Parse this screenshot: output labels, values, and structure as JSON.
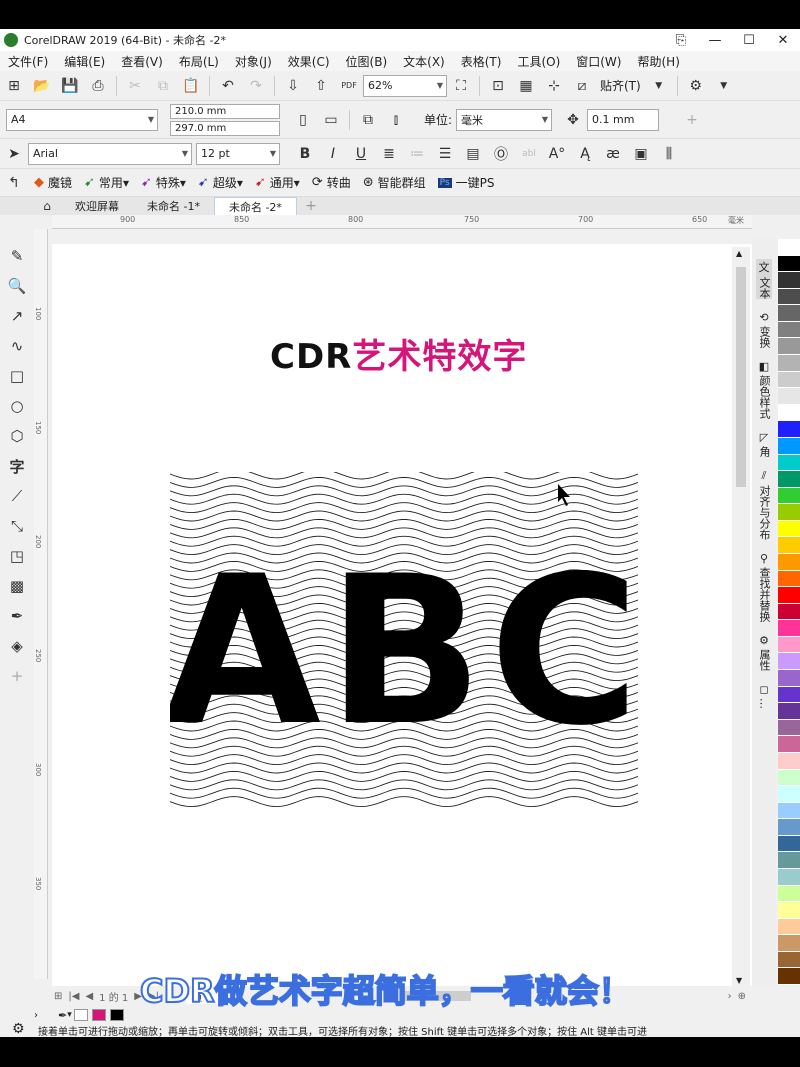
{
  "window": {
    "title": "CorelDRAW 2019 (64-Bit) - 未命名 -2*",
    "controls": [
      "⎘",
      "—",
      "☐",
      "✕"
    ]
  },
  "menu": [
    "文件(F)",
    "编辑(E)",
    "查看(V)",
    "布局(L)",
    "对象(J)",
    "效果(C)",
    "位图(B)",
    "文本(X)",
    "表格(T)",
    "工具(O)",
    "窗口(W)",
    "帮助(H)"
  ],
  "toolbar1": {
    "zoom": "62%",
    "snap_label": "贴齐(T)",
    "pdf_label": "PDF"
  },
  "toolbar2": {
    "page_size": "A4",
    "width": "210.0 mm",
    "height": "297.0 mm",
    "unit_label": "单位:",
    "unit_value": "毫米",
    "nudge": "0.1 mm"
  },
  "toolbar3": {
    "font": "Arial",
    "font_size": "12 pt"
  },
  "plugins": [
    "魔镜",
    "常用",
    "特殊",
    "超级",
    "通用",
    "转曲",
    "智能群组",
    "一键PS"
  ],
  "tabs": [
    "欢迎屏幕",
    "未命名 -1*",
    "未命名 -2*"
  ],
  "ruler_h": [
    "900",
    "850",
    "800",
    "750",
    "700",
    "650",
    "毫米"
  ],
  "ruler_v": [
    "100",
    "150",
    "200",
    "250",
    "300",
    "350",
    "400",
    "450",
    "500"
  ],
  "artwork": {
    "title_black": "CDR",
    "title_pink": "艺术特效字",
    "letters": "ABC"
  },
  "dockers": [
    {
      "icon": "文",
      "label": "文本"
    },
    {
      "icon": "⟲",
      "label": "变换"
    },
    {
      "icon": "◧",
      "label": "颜色样式"
    },
    {
      "icon": "◸",
      "label": "角"
    },
    {
      "icon": "⫽",
      "label": "对齐与分布"
    },
    {
      "icon": "⚲",
      "label": "查找并替换"
    },
    {
      "icon": "⚙",
      "label": "属性"
    },
    {
      "icon": "◻",
      "label": "…"
    }
  ],
  "palette": [
    "#ffffff",
    "#000000",
    "#333333",
    "#4d4d4d",
    "#666666",
    "#808080",
    "#999999",
    "#b3b3b3",
    "#cccccc",
    "#e6e6e6",
    "#ffffff",
    "#1f1fff",
    "#0099ff",
    "#00cccc",
    "#009966",
    "#33cc33",
    "#99cc00",
    "#ffff00",
    "#ffcc00",
    "#ff9900",
    "#ff6600",
    "#ff0000",
    "#cc0033",
    "#ff3399",
    "#ff99cc",
    "#cc99ff",
    "#9966cc",
    "#6633cc",
    "#663399",
    "#996699",
    "#cc6699",
    "#ffcccc",
    "#ccffcc",
    "#ccffff",
    "#99ccff",
    "#6699cc",
    "#336699",
    "#669999",
    "#99cccc",
    "#ccff99",
    "#ffff99",
    "#ffcc99",
    "#cc9966",
    "#996633",
    "#663300"
  ],
  "pagebar": {
    "page_label": "页 1",
    "page_count": "1 的 1"
  },
  "statusbar": {
    "text": "接着单击可进行拖动或缩放；再单击可旋转或倾斜；双击工具，可选择所有对象；按住 Shift 键单击可选择多个对象；按住 Alt 键单击可进"
  },
  "caption": "CDR做艺术字超简单，一看就会！",
  "colors": {
    "accent_pink": "#d4157a",
    "caption_stroke": "#3b6fe0"
  }
}
